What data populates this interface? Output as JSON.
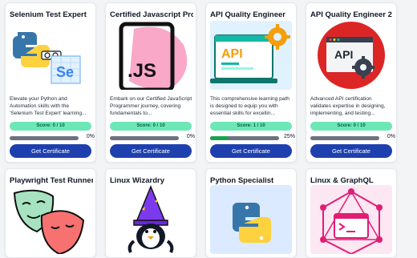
{
  "cards": [
    {
      "title": "Selenium Test Expert",
      "description": "Elevate your Python and Automation skills with the 'Selenium Test Expert' learning...",
      "score": "Score: 0 / 10",
      "progress_percent": 0,
      "progress_label": "0%",
      "button": "Get Certificate",
      "icon": "selenium-python-icon"
    },
    {
      "title": "Certified Javascript Prog...",
      "description": "Embark on our Certified JavaScript Programmer journey, covering fundamentals to...",
      "score": "Score: 0 / 10",
      "progress_percent": 0,
      "progress_label": "0%",
      "button": "Get Certificate",
      "icon": "javascript-file-icon",
      "icon_text": ".JS"
    },
    {
      "title": "API Quality Engineer",
      "description": "This comprehensive learning path is designed to equip you with essential skills for excellin...",
      "score": "Score: 1 / 10",
      "progress_percent": 25,
      "progress_label": "25%",
      "button": "Get Certificate",
      "icon": "api-browser-gear-icon",
      "icon_text": "API"
    },
    {
      "title": "API Quality Engineer 2",
      "description": "Advanced API certification validates expertise in designing, implementing, and testing...",
      "score": "Score: 0 / 10",
      "progress_percent": 0,
      "progress_label": "0%",
      "button": "Get Certificate",
      "icon": "api-window-gear-icon",
      "icon_text": "API"
    },
    {
      "title": "Playwright Test Runner",
      "icon": "playwright-masks-icon"
    },
    {
      "title": "Linux Wizardry",
      "icon": "penguin-wizard-icon"
    },
    {
      "title": "Python Specialist",
      "icon": "python-logo-icon"
    },
    {
      "title": "Linux & GraphQL",
      "icon": "terminal-graphql-icon"
    }
  ],
  "colors": {
    "button": "#1e40af",
    "score_badge": "#6ee7b7",
    "progress_track": "#6b7280",
    "progress_fill": "#16a34a"
  }
}
